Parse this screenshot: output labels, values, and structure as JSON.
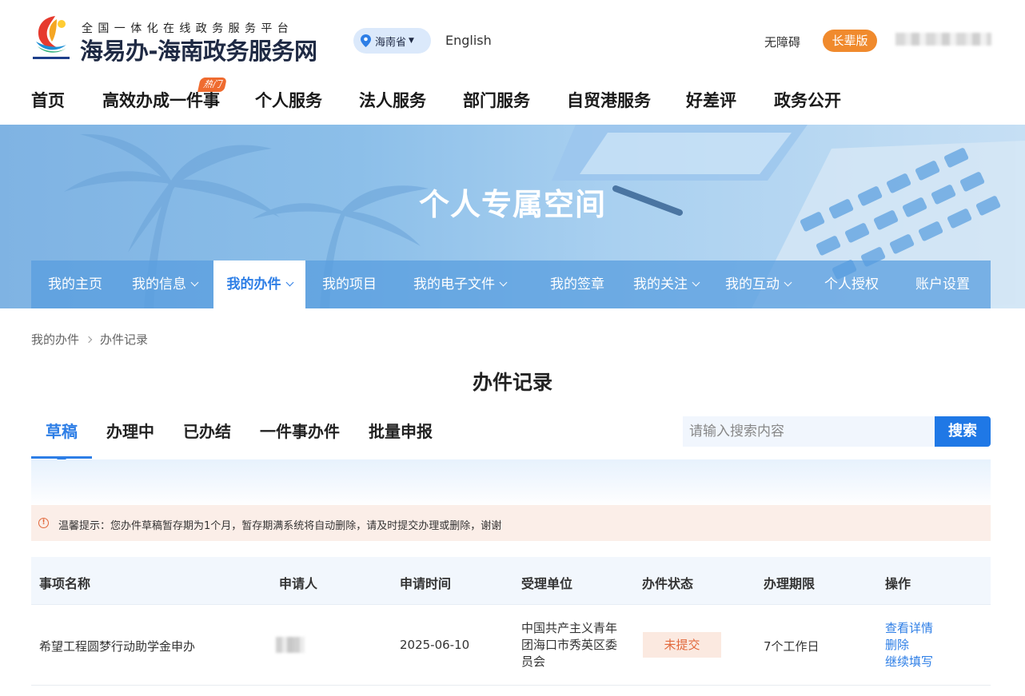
{
  "header": {
    "slogan": "全国一体化在线政务服务平台",
    "site_name": "海易办-海南政务服务网",
    "region": "海南省",
    "language": "English",
    "accessibility": "无障碍",
    "elder_mode": "长辈版",
    "colors": {
      "accent": "#2d7ee6",
      "elder": "#f08a2d"
    }
  },
  "main_nav": {
    "items": [
      "首页",
      "高效办成一件事",
      "个人服务",
      "法人服务",
      "部门服务",
      "自贸港服务",
      "好差评",
      "政务公开"
    ],
    "hot_badge": "热门"
  },
  "banner": {
    "title": "个人专属空间"
  },
  "sub_nav": {
    "items": [
      "我的主页",
      "我的信息",
      "我的办件",
      "我的项目",
      "我的电子文件",
      "我的签章",
      "我的关注",
      "我的互动",
      "个人授权",
      "账户设置"
    ],
    "active": "我的办件"
  },
  "breadcrumb": {
    "items": [
      "我的办件",
      "办件记录"
    ]
  },
  "page_title": "办件记录",
  "tabs": {
    "items": [
      "草稿",
      "办理中",
      "已办结",
      "一件事办件",
      "批量申报"
    ],
    "active": "草稿"
  },
  "search": {
    "placeholder": "请输入搜索内容",
    "button": "搜索"
  },
  "notice": {
    "icon": "info-icon",
    "text": "温馨提示：您办件草稿暂存期为1个月，暂存期满系统将自动删除，请及时提交办理或删除，谢谢"
  },
  "table": {
    "headers": [
      "事项名称",
      "申请人",
      "申请时间",
      "受理单位",
      "办件状态",
      "办理期限",
      "操作"
    ],
    "rows": [
      {
        "name": "希望工程圆梦行动助学金申办",
        "date": "2025-06-10",
        "unit_lines": [
          "中国共产主义青年",
          "团海口市秀英区委",
          "员会"
        ],
        "status": "未提交",
        "deadline": "7个工作日",
        "actions": [
          "查看详情",
          "删除",
          "继续填写"
        ]
      }
    ]
  }
}
